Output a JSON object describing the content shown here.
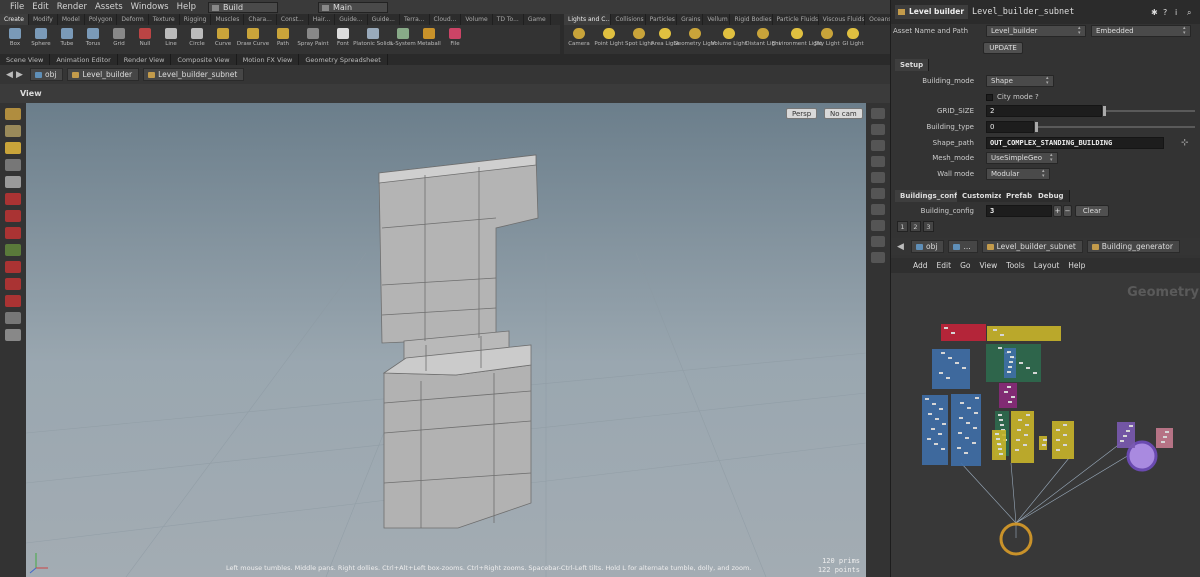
{
  "menubar": {
    "items": [
      "File",
      "Edit",
      "Render",
      "Assets",
      "Windows",
      "Help"
    ],
    "desktop": "Build",
    "context": "Main"
  },
  "shelf_left": {
    "tabs": [
      "Create",
      "Modify",
      "Model",
      "Polygon",
      "Deform",
      "Texture",
      "Rigging",
      "Muscles",
      "Chara...",
      "Const...",
      "Hair...",
      "Guide...",
      "Guide...",
      "Terra...",
      "Cloud...",
      "Volume",
      "TD To...",
      "Game"
    ],
    "tools": [
      "Box",
      "Sphere",
      "Tube",
      "Torus",
      "Grid",
      "Null",
      "Line",
      "Circle",
      "Curve",
      "Draw Curve",
      "Path",
      "Spray Paint",
      "Font",
      "Platonic Solids",
      "L-System",
      "Metaball",
      "File"
    ]
  },
  "shelf_right": {
    "tabs": [
      "Lights and C...",
      "Collisions",
      "Particles",
      "Grains",
      "Vellum",
      "Rigid Bodies",
      "Particle Fluids",
      "Viscous Fluids",
      "Oceans"
    ],
    "tools": [
      "Camera",
      "Point Light",
      "Spot Light",
      "Area Light",
      "Geometry Light",
      "Volume Light",
      "Distant Light",
      "Environment Light",
      "Sky Light",
      "GI Light"
    ]
  },
  "pane_tabs": [
    "Scene View",
    "Animation Editor",
    "Render View",
    "Composite View",
    "Motion FX View",
    "Geometry Spreadsheet"
  ],
  "path": {
    "crumbs": [
      "obj",
      "Level_builder",
      "Level_builder_subnet"
    ]
  },
  "view": {
    "title": "View",
    "persp": "Persp",
    "cam": "No cam",
    "status": "Left mouse tumbles. Middle pans. Right dollies. Ctrl+Alt+Left box-zooms. Ctrl+Right zooms. Spacebar-Ctrl-Left tilts. Hold L for alternate tumble, dolly, and zoom.",
    "prims": "120  prims",
    "points": "122 points"
  },
  "params": {
    "tab_label": "Level builder",
    "node_name": "Level_builder_subnet",
    "asset_label": "Asset Name and Path",
    "asset_value": "Level_builder",
    "embedded": "Embedded",
    "update": "UPDATE",
    "setup_tab": "Setup",
    "building_mode_label": "Building_mode",
    "building_mode": "Shape",
    "city_mode": "City mode ?",
    "grid_size_label": "GRID_SIZE",
    "grid_size": "2",
    "building_type_label": "Building_type",
    "building_type": "0",
    "shape_path_label": "Shape_path",
    "shape_path": "OUT_COMPLEX_STANDING_BUILDING",
    "mesh_mode_label": "Mesh_mode",
    "mesh_mode": "UseSimpleGeo",
    "wall_mode_label": "Wall mode",
    "wall_mode": "Modular",
    "folder_tabs": [
      "Buildings_config",
      "Customize",
      "Prefab",
      "Debug"
    ],
    "building_config_label": "Building_config",
    "building_config": "3",
    "clear": "Clear",
    "multi_tabs": [
      "1",
      "2",
      "3"
    ]
  },
  "network": {
    "crumbs": [
      "obj",
      "...",
      "Level_builder_subnet",
      "Building_generator"
    ],
    "menu": [
      "Add",
      "Edit",
      "Go",
      "View",
      "Tools",
      "Layout",
      "Help"
    ],
    "context_label": "Geometry"
  },
  "colors": {
    "red": "#c2243a",
    "yellow": "#c9b52a",
    "blue": "#3f6fa8",
    "green": "#2e6a4e",
    "magenta": "#8a2a7a",
    "purple": "#7a5ab0",
    "pink": "#c47a8e",
    "orange": "#c9922a"
  }
}
